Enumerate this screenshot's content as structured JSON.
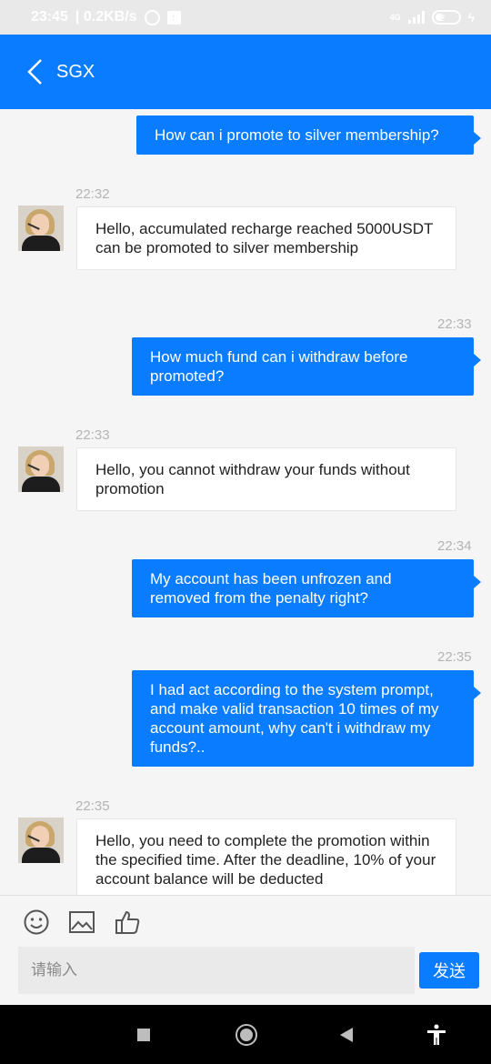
{
  "status_bar": {
    "time": "23:45",
    "net_speed": "| 0.2KB/s",
    "network_type": "4G",
    "battery": "35"
  },
  "header": {
    "title": "SGX",
    "back_icon": "chevron-left-icon"
  },
  "messages": [
    {
      "side": "out",
      "time": "",
      "text": "How can i promote to silver membership?"
    },
    {
      "side": "in",
      "time": "22:32",
      "text": "Hello, accumulated recharge reached 5000USDT can be promoted to silver membership"
    },
    {
      "side": "out",
      "time": "22:33",
      "text": "How much fund can i withdraw before promoted?"
    },
    {
      "side": "in",
      "time": "22:33",
      "text": "Hello, you cannot withdraw your funds without promotion"
    },
    {
      "side": "out",
      "time": "22:34",
      "text": "My account has been unfrozen and removed from the penalty right?"
    },
    {
      "side": "out",
      "time": "22:35",
      "text": "I had act according to the system prompt, and make valid transaction 10 times of my account amount, why can't i withdraw my funds?.."
    },
    {
      "side": "in",
      "time": "22:35",
      "text": "Hello, you need to complete the promotion within the specified time. After the deadline, 10% of your account balance will be deducted"
    }
  ],
  "composer": {
    "placeholder": "请输入",
    "send_label": "发送",
    "tools": [
      "emoji-icon",
      "image-icon",
      "thumbs-up-icon"
    ]
  },
  "nav_bar": {
    "buttons": [
      "square-icon",
      "home-circle-icon",
      "back-triangle-icon",
      "accessibility-icon"
    ]
  },
  "colors": {
    "accent": "#0a7cff",
    "background": "#f5f5f5",
    "status_bar": "#e9e9e9",
    "timestamp": "#b4b4b4"
  }
}
